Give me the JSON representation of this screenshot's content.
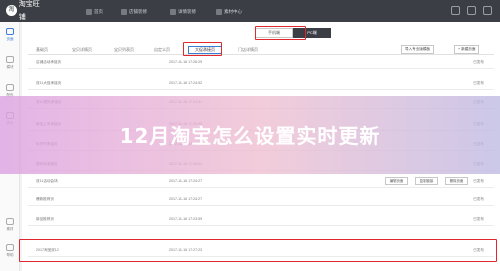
{
  "topbar": {
    "logo_text": "淘宝旺铺",
    "nav": [
      {
        "label": "首页",
        "active": false
      },
      {
        "label": "店铺装修",
        "active": true
      },
      {
        "label": "详情装修",
        "active": false
      },
      {
        "label": "素材中心",
        "active": false
      }
    ]
  },
  "sidebar": {
    "items": [
      {
        "label": "页面",
        "active": true
      },
      {
        "label": "模块",
        "active": false
      },
      {
        "label": "配色",
        "active": false
      },
      {
        "label": "页头",
        "active": false
      },
      {
        "label": "素材",
        "active": false
      },
      {
        "label": "帮助",
        "active": false
      }
    ]
  },
  "segment": {
    "left": "手机端",
    "right": "PC端"
  },
  "tabs": [
    "基础页",
    "宝贝详情页",
    "宝贝列表页",
    "自定义页",
    "大促承接页",
    "门店详情页"
  ],
  "active_tab_index": 4,
  "actions": {
    "new_page": "+ 新建页面",
    "import": "导入专业版模板"
  },
  "rows": [
    {
      "name": "店铺活动承接页",
      "time": "2017-11-16 17:26:29",
      "status": "已发布",
      "buttons": []
    },
    {
      "name": "双11大促承接页",
      "time": "2017-11-16 17:24:52",
      "status": "已发布",
      "buttons": []
    },
    {
      "name": "双12预热承接页",
      "time": "2017-11-16 17:24:31",
      "status": "已发布",
      "buttons": []
    },
    {
      "name": "新品上市承接页",
      "time": "2017-11-16 17:25:08",
      "status": "已发布",
      "buttons": []
    },
    {
      "name": "年货节承接页",
      "time": "2017-11-16 17:25:44",
      "status": "已发布",
      "buttons": []
    },
    {
      "name": "周年庆承接页",
      "time": "2017-11-16 17:26:03",
      "status": "已发布",
      "buttons": []
    },
    {
      "name": "双11活动会场",
      "time": "2017-11-16 17:24:27",
      "status": "已发布",
      "buttons": [
        "编辑页面",
        "复制链接",
        "删除页面"
      ]
    },
    {
      "name": "爆款推荐页",
      "time": "2017-11-16 17:24:27",
      "status": "已发布",
      "buttons": []
    },
    {
      "name": "新品推荐页",
      "time": "2017-11-16 17:23:59",
      "status": "已发布",
      "buttons": []
    },
    {
      "name": "2017淘宝双12",
      "time": "2017-11-16 17:27:23",
      "status": "已发布",
      "buttons": []
    }
  ],
  "headline": "12月淘宝怎么设置实时更新",
  "colors": {
    "highlight": "#e0282e",
    "topbar": "#3b3e44",
    "accent": "#3b7bd4"
  }
}
